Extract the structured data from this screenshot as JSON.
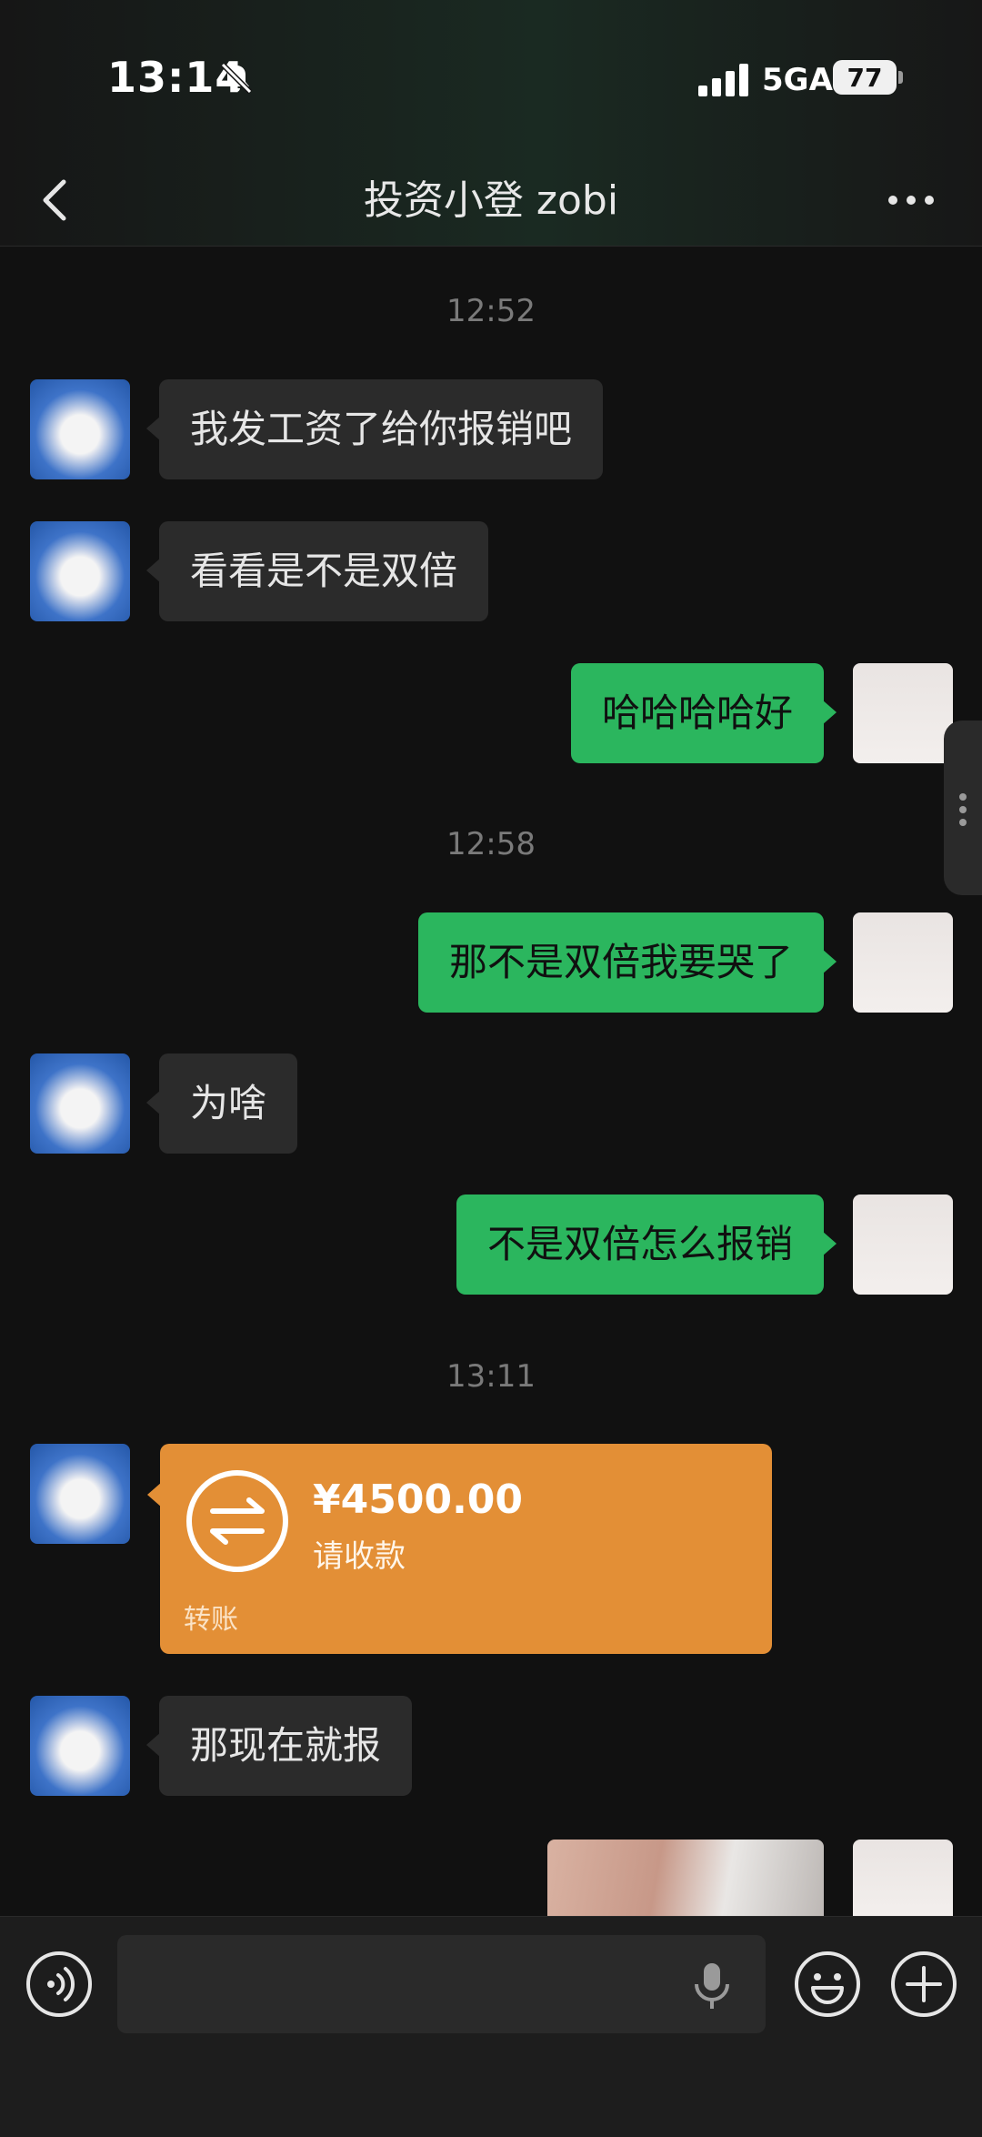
{
  "status_bar": {
    "time": "13:14",
    "network": "5GA",
    "battery": "77"
  },
  "header": {
    "title": "投资小登 zobi"
  },
  "timestamps": [
    "12:52",
    "12:58",
    "13:11"
  ],
  "messages": [
    {
      "side": "in",
      "text": "我发工资了给你报销吧"
    },
    {
      "side": "in",
      "text": "看看是不是双倍"
    },
    {
      "side": "out",
      "text": "哈哈哈哈好"
    },
    {
      "side": "out",
      "text": "那不是双倍我要哭了"
    },
    {
      "side": "in",
      "text": "为啥"
    },
    {
      "side": "out",
      "text": "不是双倍怎么报销"
    },
    {
      "side": "in",
      "text": "那现在就报"
    }
  ],
  "transfer": {
    "amount": "¥4500.00",
    "subtitle": "请收款",
    "label": "转账",
    "color": "#e38f36"
  },
  "input": {
    "value": "",
    "placeholder": ""
  },
  "colors": {
    "outgoing_bubble": "#2bb65e",
    "incoming_bubble": "#2b2b2b",
    "background": "#111111"
  },
  "icons": [
    "bell-off-icon",
    "signal-icon",
    "back-icon",
    "more-icon",
    "transfer-icon",
    "voice-icon",
    "microphone-icon",
    "emoji-icon",
    "plus-icon"
  ]
}
